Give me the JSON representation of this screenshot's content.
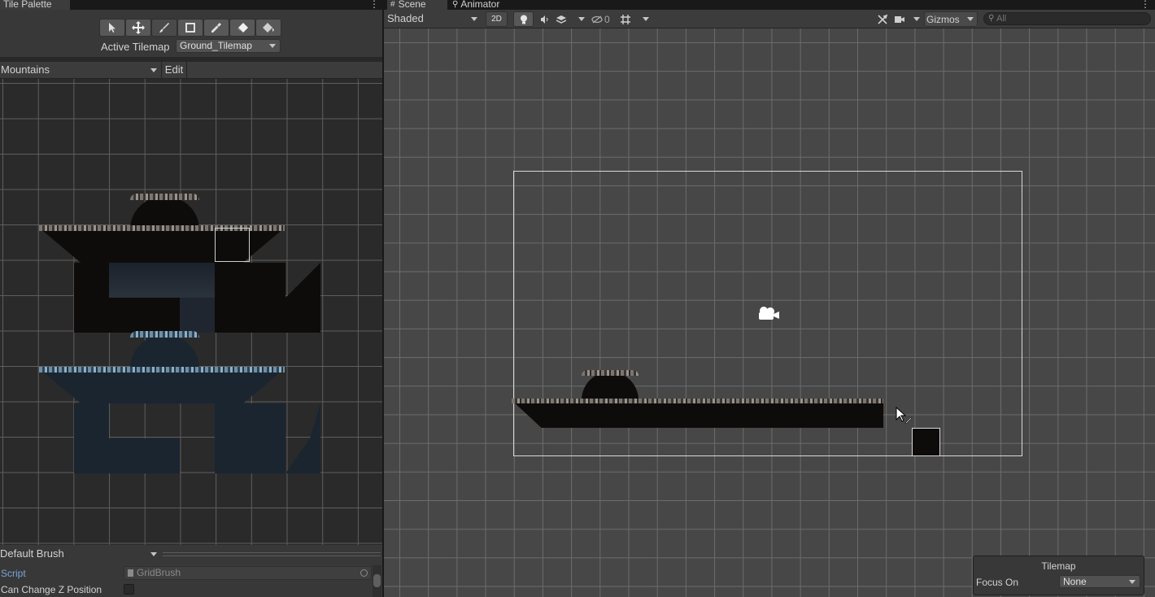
{
  "left_panel": {
    "tab_title": "Tile Palette",
    "active_tilemap_label": "Active Tilemap",
    "active_tilemap_value": "Ground_Tilemap",
    "palette_value": "Mountains",
    "edit_label": "Edit",
    "brush_value": "Default Brush",
    "script_label": "Script",
    "script_value": "GridBrush",
    "can_change_z_label": "Can Change Z Position",
    "tools": [
      "select-icon",
      "move-icon",
      "paint-brush-icon",
      "box-fill-icon",
      "picker-icon",
      "eraser-icon",
      "fill-bucket-icon"
    ]
  },
  "right_panel": {
    "tabs": [
      {
        "label": "Scene"
      },
      {
        "label": "Animator"
      }
    ],
    "shading_value": "Shaded",
    "mode_2d_label": "2D",
    "hidden_count": "0",
    "gizmos_label": "Gizmos",
    "search_placeholder": "All"
  },
  "tilemap_overlay": {
    "title": "Tilemap",
    "focus_label": "Focus On",
    "focus_value": "None"
  },
  "colors": {
    "accent": "#7ba4d8",
    "panel_bg": "#282828",
    "scene_bg": "#474747"
  }
}
